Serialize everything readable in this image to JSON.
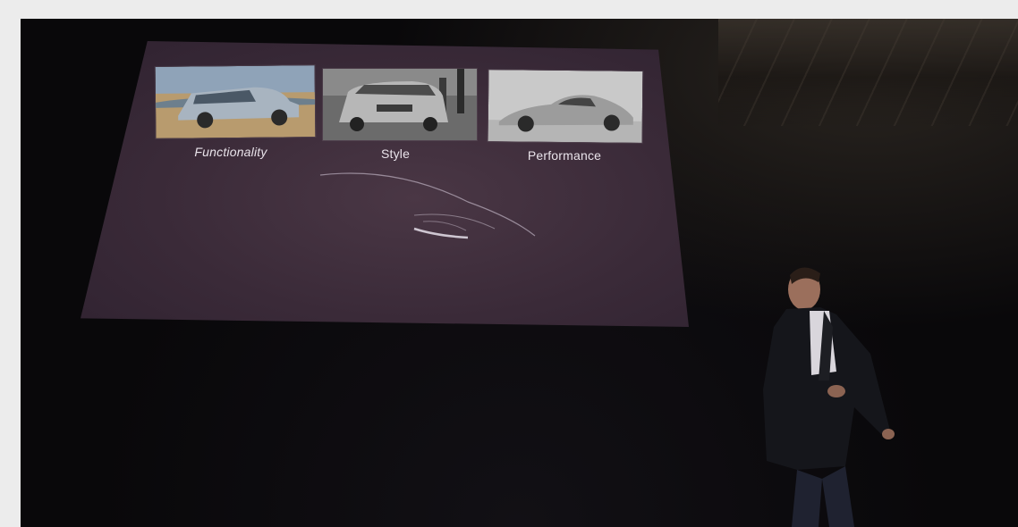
{
  "slide": {
    "captions": [
      "Functionality",
      "Style",
      "Performance"
    ],
    "images": [
      {
        "icon": "minivan-photo-icon"
      },
      {
        "icon": "suv-photo-icon"
      },
      {
        "icon": "sports-car-photo-icon"
      }
    ],
    "silhouette_icon": "car-silhouette-icon"
  },
  "stage": {
    "speaker_icon": "presenter-figure-icon"
  },
  "colors": {
    "screen": "#3a2a38",
    "background": "#0b0a0c",
    "caption_text": "#e9e3ea",
    "page_border": "#ececec"
  }
}
